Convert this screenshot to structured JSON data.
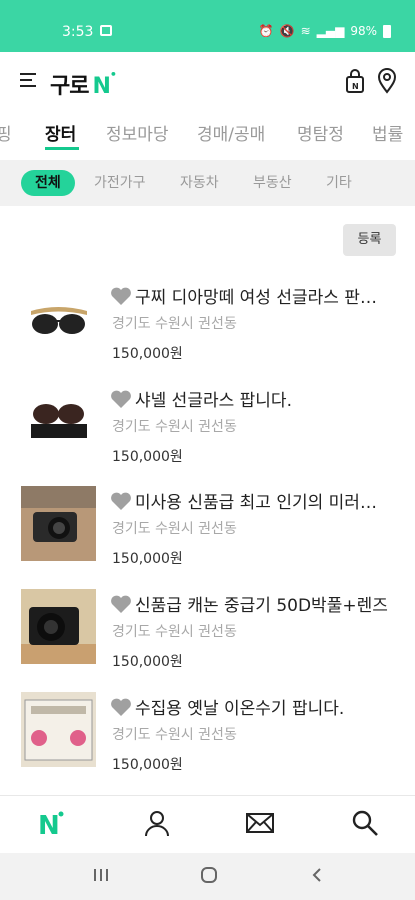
{
  "status_bar": {
    "time": "3:53",
    "battery": "98%"
  },
  "header": {
    "logo_text": "구로",
    "logo_n": "N",
    "logo_dot": "•"
  },
  "tabs": [
    {
      "label": "핑"
    },
    {
      "label": "장터"
    },
    {
      "label": "정보마당"
    },
    {
      "label": "경매/공매"
    },
    {
      "label": "명탐정"
    },
    {
      "label": "법률"
    }
  ],
  "subtabs": [
    {
      "label": "전체"
    },
    {
      "label": "가전가구"
    },
    {
      "label": "자동차"
    },
    {
      "label": "부동산"
    },
    {
      "label": "기타"
    }
  ],
  "register_label": "등록",
  "listings": [
    {
      "title": "구찌 디아망떼 여성 선글라스 판매합니다",
      "location": "경기도 수원시 권선동",
      "price": "150,000원"
    },
    {
      "title": "샤넬 선글라스 팝니다.",
      "location": "경기도 수원시 권선동",
      "price": "150,000원"
    },
    {
      "title": "미사용 신품급 최고 인기의 미러리스 카메라",
      "location": "경기도 수원시 권선동",
      "price": "150,000원"
    },
    {
      "title": "신품급 캐논 중급기 50D박풀+렌즈",
      "location": "경기도 수원시 권선동",
      "price": "150,000원"
    },
    {
      "title": "수집용 옛날 이온수기 팝니다.",
      "location": "경기도 수원시 권선동",
      "price": "150,000원"
    }
  ],
  "colors": {
    "accent": "#14c98e",
    "status_bar": "#3bd6a4",
    "chip_active": "#24d39a"
  }
}
